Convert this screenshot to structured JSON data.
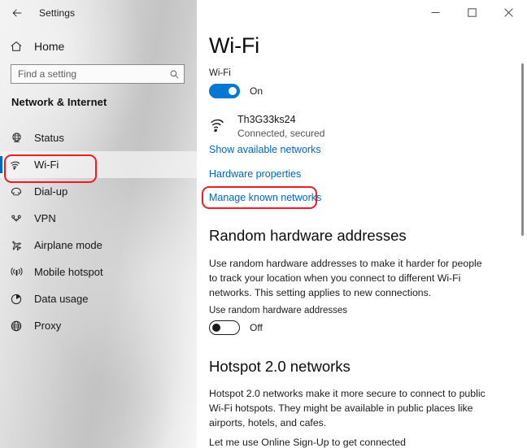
{
  "window": {
    "app_title": "Settings",
    "back_icon": "back-arrow-icon",
    "controls": {
      "minimize": "minimize-icon",
      "maximize": "maximize-icon",
      "close": "close-icon"
    }
  },
  "sidebar": {
    "home_label": "Home",
    "home_icon": "home-icon",
    "search": {
      "placeholder": "Find a setting",
      "value": "",
      "icon": "search-icon"
    },
    "heading": "Network & Internet",
    "items": [
      {
        "label": "Status",
        "icon": "globe-status-icon",
        "selected": false
      },
      {
        "label": "Wi-Fi",
        "icon": "wifi-icon",
        "selected": true
      },
      {
        "label": "Dial-up",
        "icon": "dialup-phone-icon",
        "selected": false
      },
      {
        "label": "VPN",
        "icon": "vpn-icon",
        "selected": false
      },
      {
        "label": "Airplane mode",
        "icon": "airplane-icon",
        "selected": false
      },
      {
        "label": "Mobile hotspot",
        "icon": "broadcast-icon",
        "selected": false
      },
      {
        "label": "Data usage",
        "icon": "pie-chart-icon",
        "selected": false
      },
      {
        "label": "Proxy",
        "icon": "globe-icon",
        "selected": false
      }
    ]
  },
  "main": {
    "page_title": "Wi-Fi",
    "wifi_toggle": {
      "label": "Wi-Fi",
      "state": "On",
      "on": true
    },
    "network": {
      "icon": "wifi-signal-icon",
      "name": "Th3G33ks24",
      "status": "Connected, secured"
    },
    "links": [
      {
        "label": "Show available networks"
      },
      {
        "label": "Hardware properties"
      },
      {
        "label": "Manage known networks"
      }
    ],
    "random_hardware": {
      "heading": "Random hardware addresses",
      "body": "Use random hardware addresses to make it harder for people to track your location when you connect to different Wi-Fi networks. This setting applies to new connections.",
      "toggle_label": "Use random hardware addresses",
      "state": "Off",
      "on": false
    },
    "hotspot": {
      "heading": "Hotspot 2.0 networks",
      "body": "Hotspot 2.0 networks make it more secure to connect to public Wi-Fi hotspots. They might be available in public places like airports, hotels, and cafes.",
      "signup_label": "Let me use Online Sign-Up to get connected"
    },
    "scrollbar": {
      "present": true
    }
  },
  "annotations": {
    "color": "#ee1b22",
    "boxes": [
      {
        "target": "sidebar-item-wi-fi"
      },
      {
        "target": "link-manage-known-networks"
      }
    ]
  }
}
